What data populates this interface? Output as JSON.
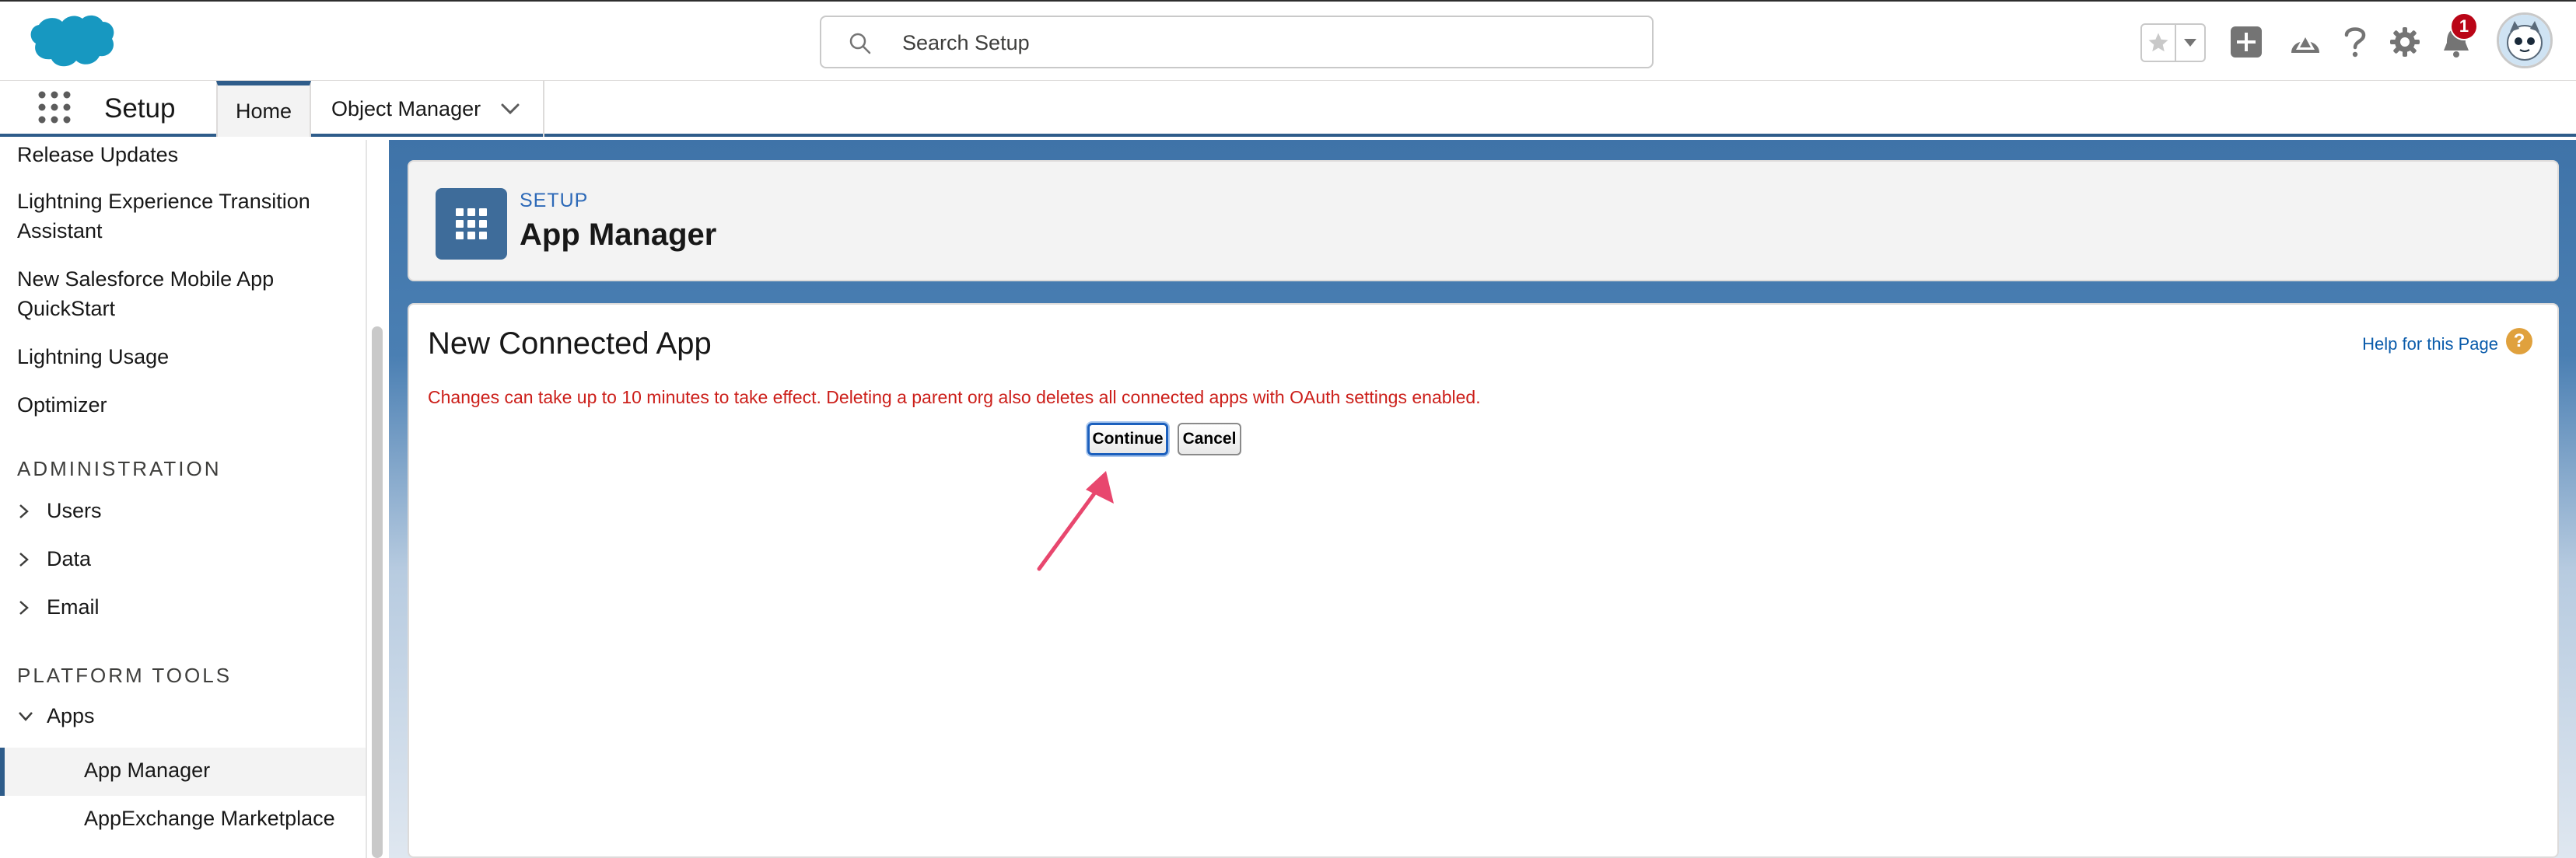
{
  "header": {
    "search_placeholder": "Search Setup",
    "notification_count": "1"
  },
  "context_bar": {
    "app_name": "Setup",
    "tabs": [
      {
        "label": "Home"
      },
      {
        "label": "Object Manager"
      }
    ]
  },
  "sidebar": {
    "items": [
      {
        "label": "Release Updates"
      },
      {
        "label": "Lightning Experience Transition Assistant"
      },
      {
        "label": "New Salesforce Mobile App QuickStart"
      },
      {
        "label": "Lightning Usage"
      },
      {
        "label": "Optimizer"
      }
    ],
    "sections": [
      {
        "label": "ADMINISTRATION"
      },
      {
        "label": "PLATFORM TOOLS"
      }
    ],
    "admin_items": [
      {
        "label": "Users"
      },
      {
        "label": "Data"
      },
      {
        "label": "Email"
      }
    ],
    "platform_items": [
      {
        "label": "Apps"
      }
    ],
    "apps_children": [
      {
        "label": "App Manager"
      },
      {
        "label": "AppExchange Marketplace"
      }
    ]
  },
  "page_header": {
    "eyebrow": "SETUP",
    "title": "App Manager"
  },
  "content": {
    "title": "New Connected App",
    "help_link": "Help for this Page",
    "help_icon": "?",
    "message": "Changes can take up to 10 minutes to take effect. Deleting a parent org also deletes all connected apps with OAuth settings enabled.",
    "continue_label": "Continue",
    "cancel_label": "Cancel"
  },
  "colors": {
    "brand_blue": "#2e5c8a",
    "message_red": "#cc1f1a",
    "annotation_pink": "#e8476e",
    "link_blue": "#0b5cab"
  }
}
